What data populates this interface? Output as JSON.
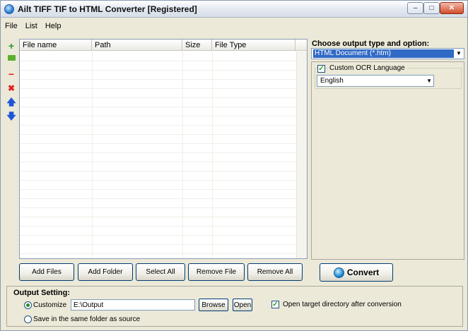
{
  "window": {
    "title": "Ailt TIFF TIF to HTML Converter [Registered]",
    "minimize": "–",
    "maximize": "□",
    "close": "✕"
  },
  "menu": [
    "File",
    "List",
    "Help"
  ],
  "toolbar_icons": [
    "add-icon",
    "folder-icon",
    "remove-icon",
    "delete-icon",
    "up-arrow-icon",
    "down-arrow-icon"
  ],
  "file_list": {
    "columns": [
      "File name",
      "Path",
      "Size",
      "File Type"
    ],
    "rows": []
  },
  "output_options": {
    "choose_label": "Choose output type and option:",
    "selected_type": "HTML Document (*.htm)",
    "custom_ocr": {
      "label": "Custom OCR Language",
      "checked": true,
      "language": "English"
    }
  },
  "buttons": {
    "add_files": "Add Files",
    "add_folder": "Add Folder",
    "select_all": "Select All",
    "remove_file": "Remove File",
    "remove_all": "Remove All",
    "convert": "Convert"
  },
  "output_setting": {
    "title": "Output Setting:",
    "customize_label": "Customize",
    "customize_selected": true,
    "path": "E:\\Output",
    "browse": "Browse",
    "open": "Open",
    "open_target_label": "Open target directory after conversion",
    "open_target_checked": true,
    "same_folder_label": "Save in the same folder as source"
  },
  "colors": {
    "window_bg": "#ece9d8",
    "selection": "#316ac5",
    "add_green": "#2a9a2a",
    "remove_red": "#e02020",
    "arrow_blue": "#1e56d8"
  }
}
